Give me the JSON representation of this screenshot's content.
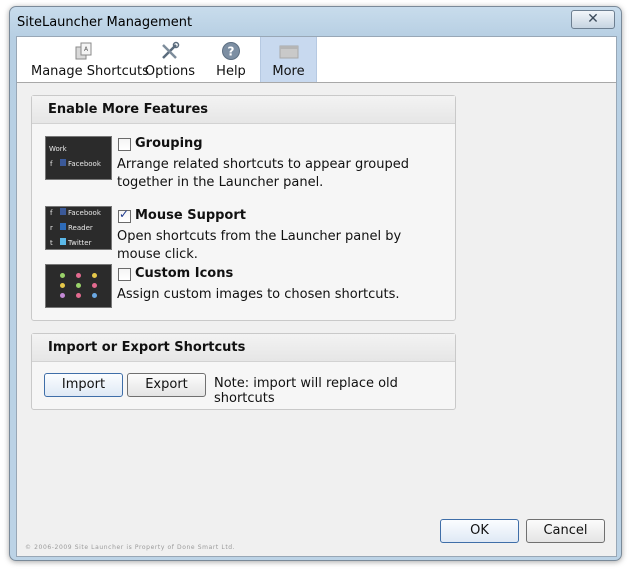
{
  "window": {
    "title": "SiteLauncher Management",
    "close_glyph": "✕"
  },
  "toolbar": {
    "items": [
      {
        "label": "Manage Shortcuts",
        "icon": "shortcuts-icon"
      },
      {
        "label": "Options",
        "icon": "tools-icon"
      },
      {
        "label": "Help",
        "icon": "help-icon"
      },
      {
        "label": "More",
        "icon": "more-icon",
        "active": true
      }
    ]
  },
  "features": {
    "heading": "Enable More Features",
    "items": [
      {
        "title": "Grouping",
        "checked": false,
        "desc": "Arrange related shortcuts to appear grouped together in the Launcher panel.",
        "thumb_text": [
          "Work",
          "f",
          "Facebook"
        ]
      },
      {
        "title": "Mouse Support",
        "checked": true,
        "desc": "Open shortcuts from the Launcher panel by mouse click.",
        "thumb_text": [
          "f",
          "Facebook",
          "r",
          "Reader",
          "t",
          "Twitter"
        ]
      },
      {
        "title": "Custom Icons",
        "checked": false,
        "desc": "Assign custom images to chosen shortcuts."
      }
    ]
  },
  "import_export": {
    "heading": "Import or Export Shortcuts",
    "import_label": "Import",
    "export_label": "Export",
    "note": "Note: import will replace old shortcuts"
  },
  "footer": {
    "copyright": "© 2006-2009 Site Launcher is Property of Done Smart Ltd.",
    "ok_label": "OK",
    "cancel_label": "Cancel"
  },
  "colors": {
    "accent": "#3f6ea8",
    "active_tab": "#c8d9ef",
    "title_bar": "#bcd3e6"
  }
}
